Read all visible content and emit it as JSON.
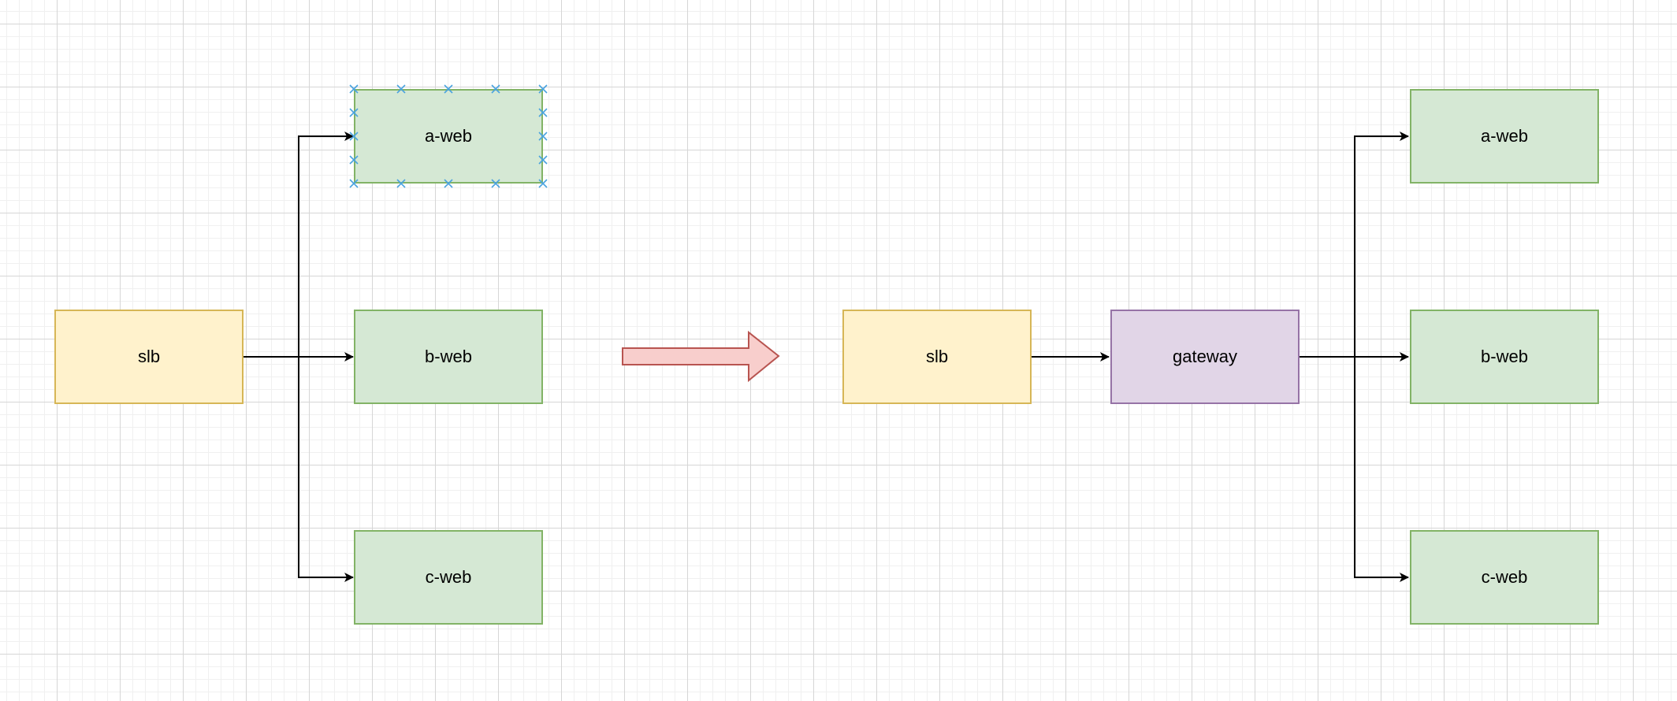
{
  "diagram": {
    "before": {
      "slb": "slb",
      "a_web": "a-web",
      "b_web": "b-web",
      "c_web": "c-web"
    },
    "after": {
      "slb": "slb",
      "gateway": "gateway",
      "a_web": "a-web",
      "b_web": "b-web",
      "c_web": "c-web"
    }
  },
  "colors": {
    "slb_fill": "#fff2cc",
    "slb_border": "#d6b656",
    "web_fill": "#d5e8d4",
    "web_border": "#82b366",
    "gateway_fill": "#e1d5e7",
    "gateway_border": "#9673a6",
    "transition_arrow_fill": "#f8cecc",
    "transition_arrow_border": "#b85450",
    "selection_marker": "#4aa3df"
  },
  "icons": {
    "transition": "right-arrow-icon",
    "selection": "selection-handle-icon"
  }
}
